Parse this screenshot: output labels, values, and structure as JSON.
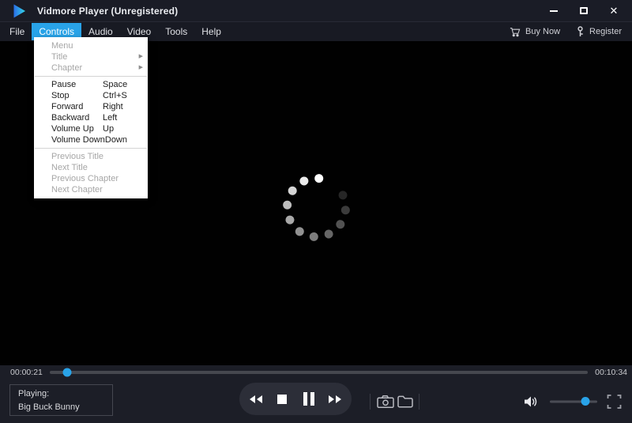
{
  "window": {
    "title": "Vidmore Player (Unregistered)"
  },
  "menubar": {
    "items": [
      {
        "label": "File",
        "active": false
      },
      {
        "label": "Controls",
        "active": true
      },
      {
        "label": "Audio",
        "active": false
      },
      {
        "label": "Video",
        "active": false
      },
      {
        "label": "Tools",
        "active": false
      },
      {
        "label": "Help",
        "active": false
      }
    ],
    "buy_now_label": "Buy Now",
    "register_label": "Register"
  },
  "controls_menu": {
    "items": [
      {
        "label": "Menu",
        "disabled": true
      },
      {
        "label": "Title",
        "disabled": true,
        "submenu": true
      },
      {
        "label": "Chapter",
        "disabled": true,
        "submenu": true
      },
      {
        "separator": true
      },
      {
        "label": "Pause",
        "shortcut": "Space"
      },
      {
        "label": "Stop",
        "shortcut": "Ctrl+S"
      },
      {
        "label": "Forward",
        "shortcut": "Right"
      },
      {
        "label": "Backward",
        "shortcut": "Left"
      },
      {
        "label": "Volume Up",
        "shortcut": "Up"
      },
      {
        "label": "Volume Down",
        "shortcut": "Down"
      },
      {
        "separator": true
      },
      {
        "label": "Previous Title",
        "disabled": true
      },
      {
        "label": "Next Title",
        "disabled": true
      },
      {
        "label": "Previous Chapter",
        "disabled": true
      },
      {
        "label": "Next Chapter",
        "disabled": true
      }
    ]
  },
  "video": {
    "state": "loading",
    "spinner_dots": 11
  },
  "seek": {
    "elapsed": "00:00:21",
    "duration": "00:10:34",
    "progress_pct": 3.2
  },
  "now_playing": {
    "label": "Playing:",
    "title": "Big Buck Bunny"
  },
  "transport": {
    "buttons": [
      "rewind",
      "stop",
      "pause",
      "fast-forward"
    ]
  },
  "snapshot_tools": {
    "icons": [
      "snapshot-camera",
      "open-folder"
    ]
  },
  "volume": {
    "level_pct": 75
  },
  "colors": {
    "accent": "#29a3e8"
  }
}
